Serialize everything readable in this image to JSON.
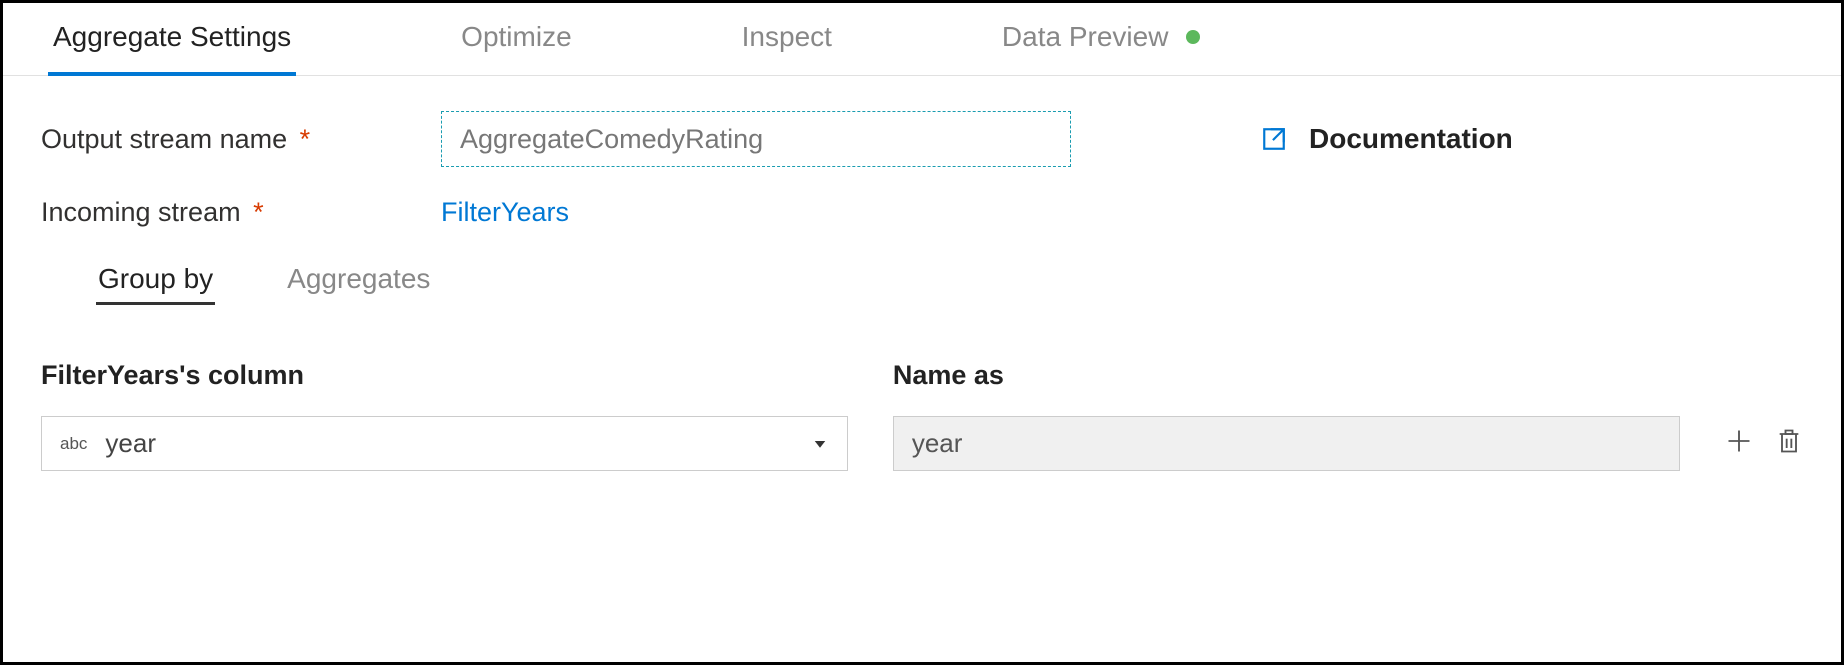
{
  "tabs": {
    "settings": "Aggregate Settings",
    "optimize": "Optimize",
    "inspect": "Inspect",
    "preview": "Data Preview"
  },
  "fields": {
    "outputStream": {
      "label": "Output stream name",
      "value": "AggregateComedyRating"
    },
    "incomingStream": {
      "label": "Incoming stream",
      "value": "FilterYears"
    }
  },
  "documentation": {
    "label": "Documentation"
  },
  "subtabs": {
    "groupby": "Group by",
    "aggregates": "Aggregates"
  },
  "group": {
    "columnHeader": "FilterYears's column",
    "columnValue": "year",
    "nameAsHeader": "Name as",
    "nameAsValue": "year"
  }
}
